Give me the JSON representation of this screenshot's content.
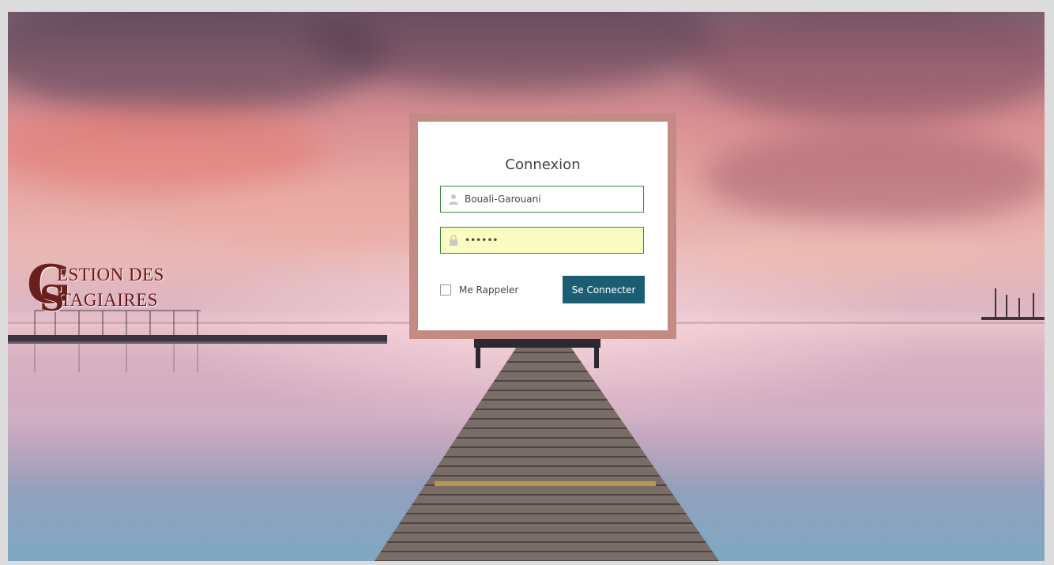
{
  "branding": {
    "logo_initial_1": "G",
    "logo_line_1": "ESTION DES",
    "logo_initial_2": "S",
    "logo_line_2": "TAGIAIRES"
  },
  "login": {
    "title": "Connexion",
    "username": {
      "value": "Bouali-Garouani",
      "icon": "user-icon"
    },
    "password": {
      "value": "••••••",
      "icon": "lock-icon"
    },
    "remember_label": "Me Rappeler",
    "remember_checked": false,
    "submit_label": "Se Connecter"
  },
  "colors": {
    "frame_border": "#c48b86",
    "button_bg": "#1b5e73",
    "field_border": "#3c8a3c",
    "password_bg": "#fafcc1",
    "logo": "#6b1e1e"
  }
}
